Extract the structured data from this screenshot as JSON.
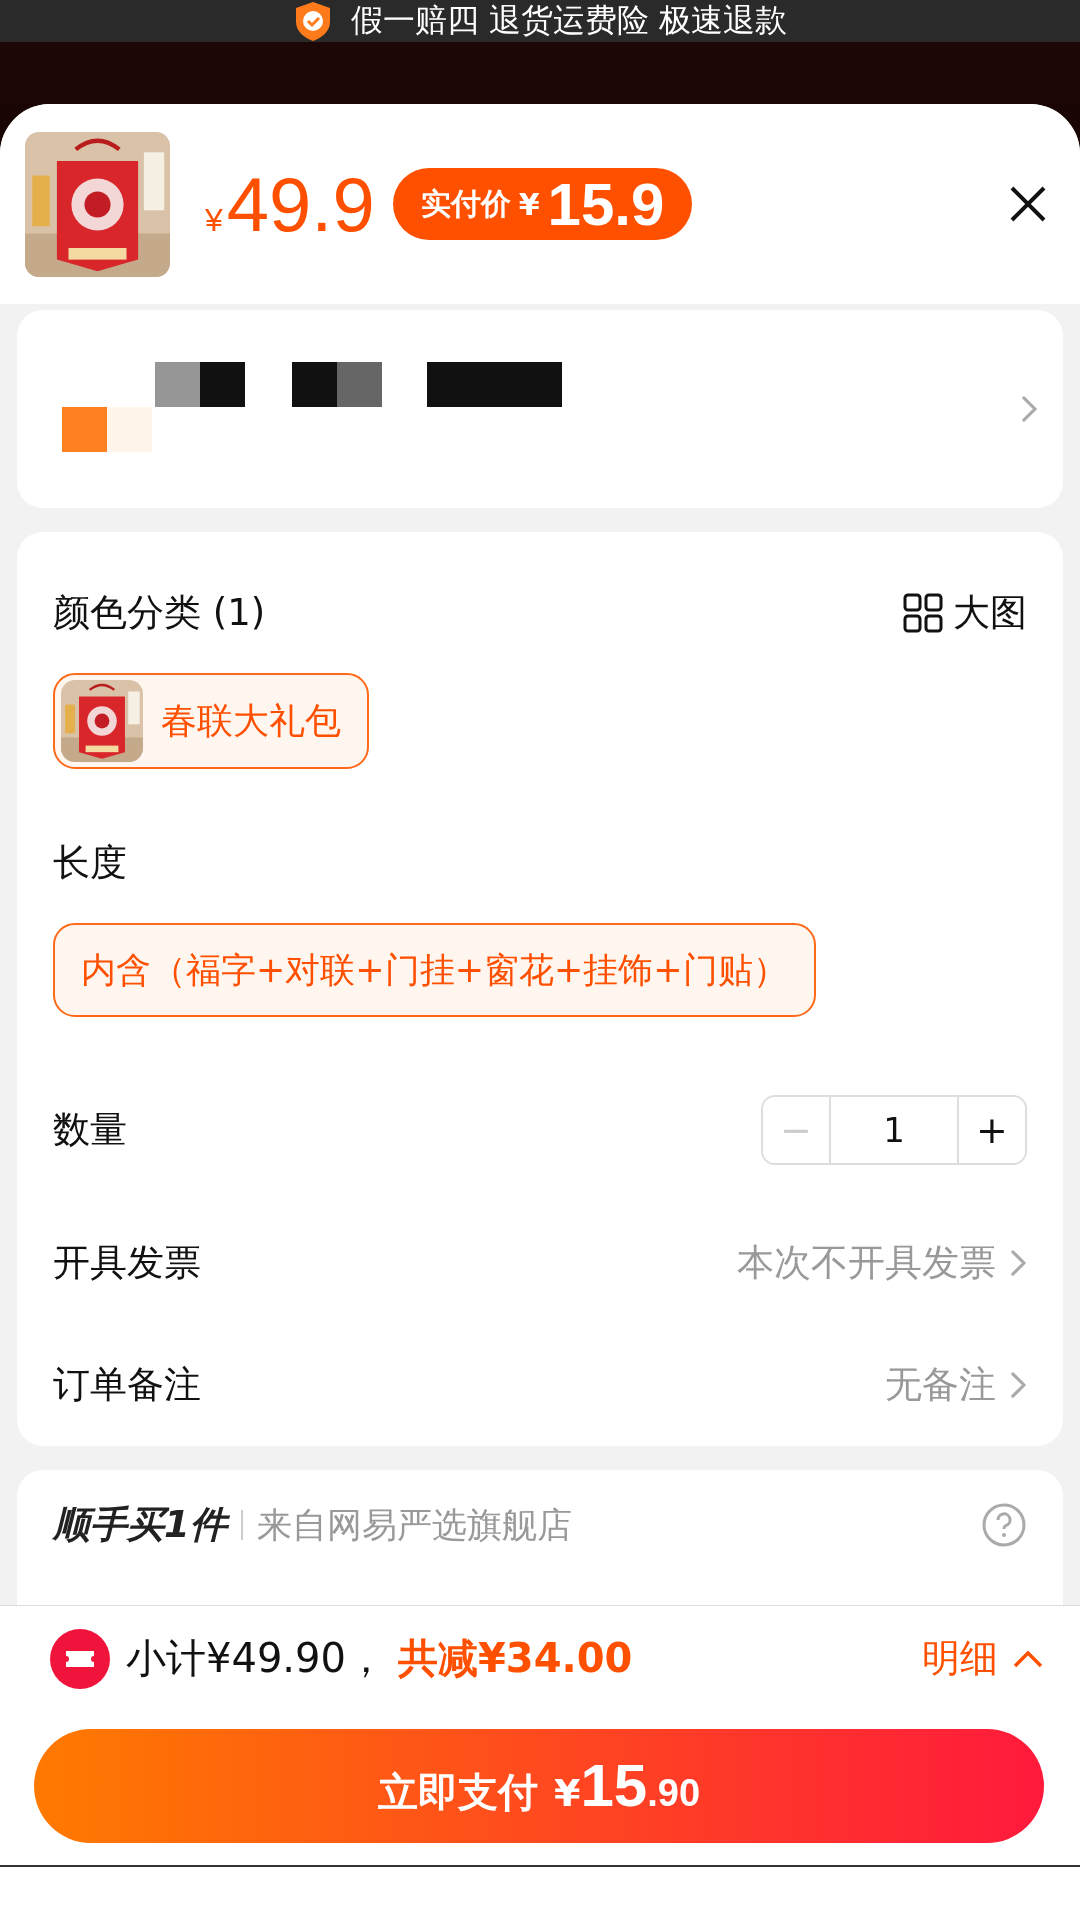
{
  "banner": {
    "text": "假一赔四 退货运费险 极速退款"
  },
  "product": {
    "currency": "¥",
    "price": "49.9",
    "badge_label": "实付价",
    "badge_currency": "¥",
    "badge_price": "15.9"
  },
  "options": [
    {
      "title": "颜色分类 (1)",
      "action": "大图",
      "chips": [
        {
          "label": "春联大礼包",
          "selected": true
        }
      ]
    },
    {
      "title": "长度",
      "chips": [
        {
          "label": "内含（福字+对联+门挂+窗花+挂饰+门贴）",
          "selected": true,
          "kind": "text"
        }
      ]
    }
  ],
  "quantity": {
    "label": "数量",
    "minus": "−",
    "value": "1",
    "plus": "+",
    "minus_disabled": true
  },
  "rows": [
    {
      "label": "开具发票",
      "value": "本次不开具发票"
    },
    {
      "label": "订单备注",
      "value": "无备注"
    }
  ],
  "addon": {
    "title": "顺手买1件",
    "source": "来自网易严选旗舰店"
  },
  "summary": {
    "subtotal": "小计¥49.90，",
    "discount": "共减¥34.00",
    "details": "明细"
  },
  "pay": {
    "label": "立即支付",
    "currency": "¥",
    "int": "15",
    "dec": ".90"
  }
}
